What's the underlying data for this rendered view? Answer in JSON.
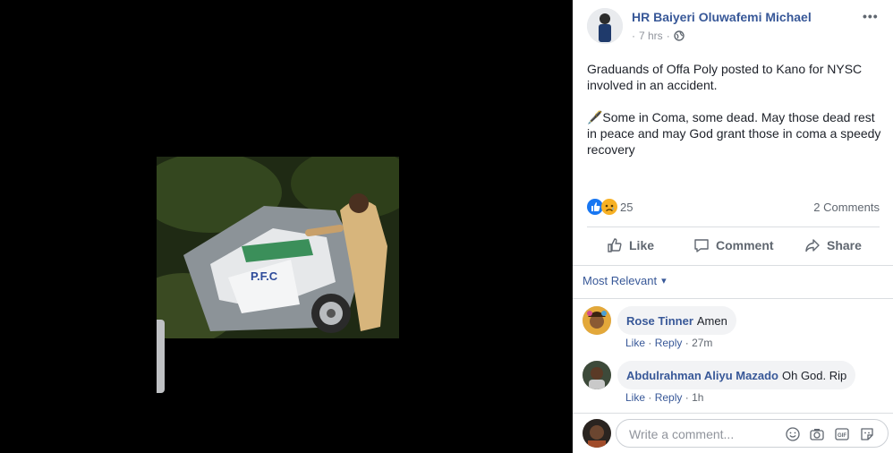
{
  "post": {
    "author": "HR Baiyeri Oluwafemi Michael",
    "time": "7 hrs",
    "separator": "·",
    "more_icon": "•••",
    "paragraphs": [
      "Graduands of Offa Poly posted to Kano for NYSC involved in an accident.",
      "🖋️Some in Coma, some dead. May those dead rest in peace and may God grant those in coma a speedy recovery"
    ],
    "photo_label": "P.F.C"
  },
  "reactions": {
    "count": "25",
    "comments_count": "2 Comments",
    "icons": [
      "like-icon",
      "sad-icon"
    ],
    "colors": {
      "like": "#1877f2",
      "sad": "#f7b125"
    }
  },
  "actions": {
    "like": "Like",
    "comment": "Comment",
    "share": "Share"
  },
  "comments_filter": {
    "label": "Most Relevant",
    "caret": "▾"
  },
  "comments": [
    {
      "author": "Rose Tinner",
      "text": "Amen",
      "like": "Like",
      "reply": "Reply",
      "dot": "·",
      "time": "27m"
    },
    {
      "author": "Abdulrahman Aliyu Mazado",
      "text": "Oh God. Rip",
      "like": "Like",
      "reply": "Reply",
      "dot": "·",
      "time": "1h"
    }
  ],
  "composer": {
    "placeholder": "Write a comment...",
    "icons": [
      "emoji-icon",
      "camera-icon",
      "gif-icon",
      "sticker-icon"
    ]
  },
  "theme": {
    "link_blue": "#385898",
    "muted": "#90949c",
    "divider": "#dadde1"
  }
}
